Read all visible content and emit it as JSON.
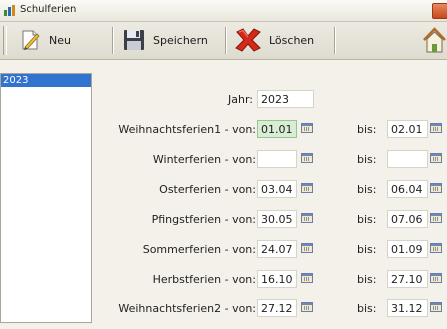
{
  "window": {
    "title": "Schulferien"
  },
  "toolbar": {
    "new_label": "Neu",
    "save_label": "Speichern",
    "delete_label": "Löschen"
  },
  "sidebar": {
    "items": [
      {
        "label": "2023"
      }
    ]
  },
  "form": {
    "year_label": "Jahr:",
    "year_value": "2023",
    "to_label": "bis:",
    "rows": [
      {
        "label": "Weihnachtsferien1 - von:",
        "from": "01.01",
        "to": "02.01"
      },
      {
        "label": "Winterferien - von:",
        "from": "",
        "to": ""
      },
      {
        "label": "Osterferien - von:",
        "from": "03.04",
        "to": "06.04"
      },
      {
        "label": "Pfingstferien - von:",
        "from": "30.05",
        "to": "07.06"
      },
      {
        "label": "Sommerferien - von:",
        "from": "24.07",
        "to": "01.09"
      },
      {
        "label": "Herbstferien - von:",
        "from": "16.10",
        "to": "27.10"
      },
      {
        "label": "Weihnachtsferien2 - von:",
        "from": "27.12",
        "to": "31.12"
      }
    ]
  },
  "icons": [
    "app-icon",
    "new-document-icon",
    "floppy-disk-icon",
    "red-x-icon",
    "home-icon",
    "calendar-icon"
  ],
  "colors": {
    "selection": "#3373d0",
    "focused_field": "#d9ecd4",
    "close_button": "#d9582a"
  }
}
